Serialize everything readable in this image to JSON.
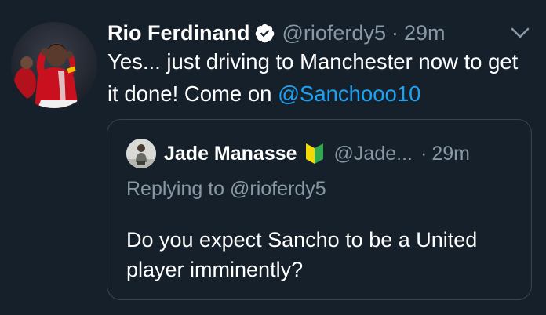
{
  "tweet": {
    "display_name": "Rio Ferdinand",
    "handle": "@rioferdy5",
    "separator": "·",
    "time": "29m",
    "text_before_mention": "Yes... just driving to Manchester now to get it done! Come on ",
    "mention": "@Sanchooo10",
    "verified_icon": "verified-badge-icon",
    "menu_icon": "chevron-down-icon"
  },
  "quote": {
    "display_name": "Jade Manasse",
    "badge_icon": "beginner-mark-icon",
    "handle": "@Jade...",
    "separator": "·",
    "time": "29m",
    "replying_to": "Replying to @rioferdy5",
    "text": "Do you expect Sancho to be a United player imminently?"
  },
  "colors": {
    "background": "#15202b",
    "text_primary": "#ffffff",
    "text_secondary": "#8899a6",
    "link": "#1da1f2",
    "border": "#38444d"
  }
}
